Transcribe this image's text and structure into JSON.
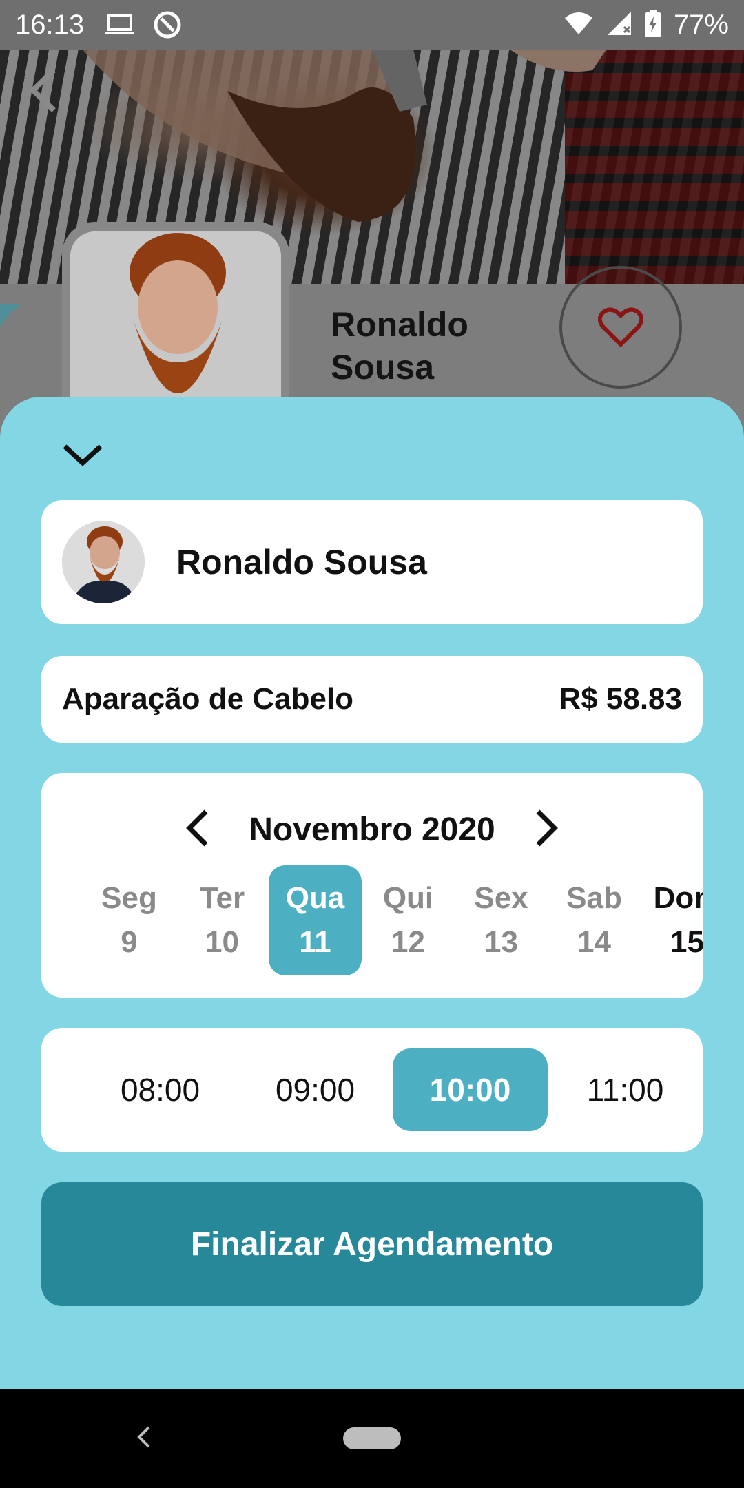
{
  "status_bar": {
    "time": "16:13",
    "battery_percent": "77%",
    "icons": [
      "laptop-icon",
      "sync-icon",
      "wifi-icon",
      "signal-icon",
      "battery-charging-icon"
    ]
  },
  "header": {
    "back_icon": "chevron-left-icon",
    "barber_name": "Ronaldo Sousa",
    "favorite_icon": "heart-icon",
    "accent_color": "#83d6e4"
  },
  "sheet": {
    "collapse_icon": "chevron-down-icon",
    "barber": {
      "name": "Ronaldo Sousa"
    },
    "service": {
      "name": "Aparação de Cabelo",
      "price": "R$ 58.83"
    },
    "calendar": {
      "month": "Novembro 2020",
      "days": [
        {
          "name": "Seg",
          "num": "9"
        },
        {
          "name": "Ter",
          "num": "10"
        },
        {
          "name": "Qua",
          "num": "11"
        },
        {
          "name": "Qui",
          "num": "12"
        },
        {
          "name": "Sex",
          "num": "13"
        },
        {
          "name": "Sab",
          "num": "14"
        },
        {
          "name": "Dom",
          "num": "15"
        }
      ],
      "selected_day": "11"
    },
    "times": {
      "slots": [
        "08:00",
        "09:00",
        "10:00",
        "11:00"
      ],
      "selected": "10:00"
    },
    "finish_label": "Finalizar Agendamento",
    "selected_color": "#4db0c2",
    "button_color": "#268898"
  }
}
